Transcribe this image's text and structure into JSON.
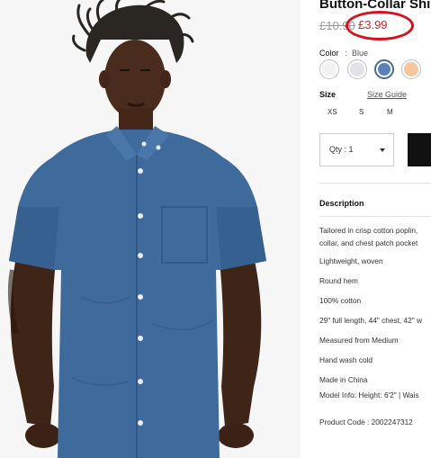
{
  "product": {
    "title": "Button-Collar Shir",
    "price_old": "£10.90",
    "price_new": "£3.99"
  },
  "color": {
    "label": "Color",
    "separator": ":",
    "value": "Blue",
    "swatches": [
      {
        "name": "white",
        "color": "#f2f2f2"
      },
      {
        "name": "light-grey",
        "color": "#e2e3e8"
      },
      {
        "name": "blue",
        "color": "#5b82b8"
      },
      {
        "name": "peach",
        "color": "#f7c59e"
      }
    ],
    "selected_index": 2
  },
  "size": {
    "label": "Size",
    "guide_label": "Size Guide",
    "options": [
      "XS",
      "S",
      "M"
    ]
  },
  "quantity": {
    "label": "Qty : 1"
  },
  "description": {
    "heading": "Description",
    "lines": [
      "Tailored in crisp cotton poplin,",
      "collar, and chest patch pocket",
      "Lightweight, woven",
      "Round hem",
      "100% cotton",
      "29\" full length, 44\" chest, 42\" w",
      "Measured from Medium",
      "Hand wash cold",
      "Made in China",
      "Model Info: Height: 6'2\" | Wais"
    ],
    "product_code_label": "Product Code : 2002247312"
  },
  "colors": {
    "sale_red": "#d6222a",
    "annotation_circle": "#d8111c",
    "shirt_blue": "#3e6a9c",
    "button_black": "#111111"
  }
}
